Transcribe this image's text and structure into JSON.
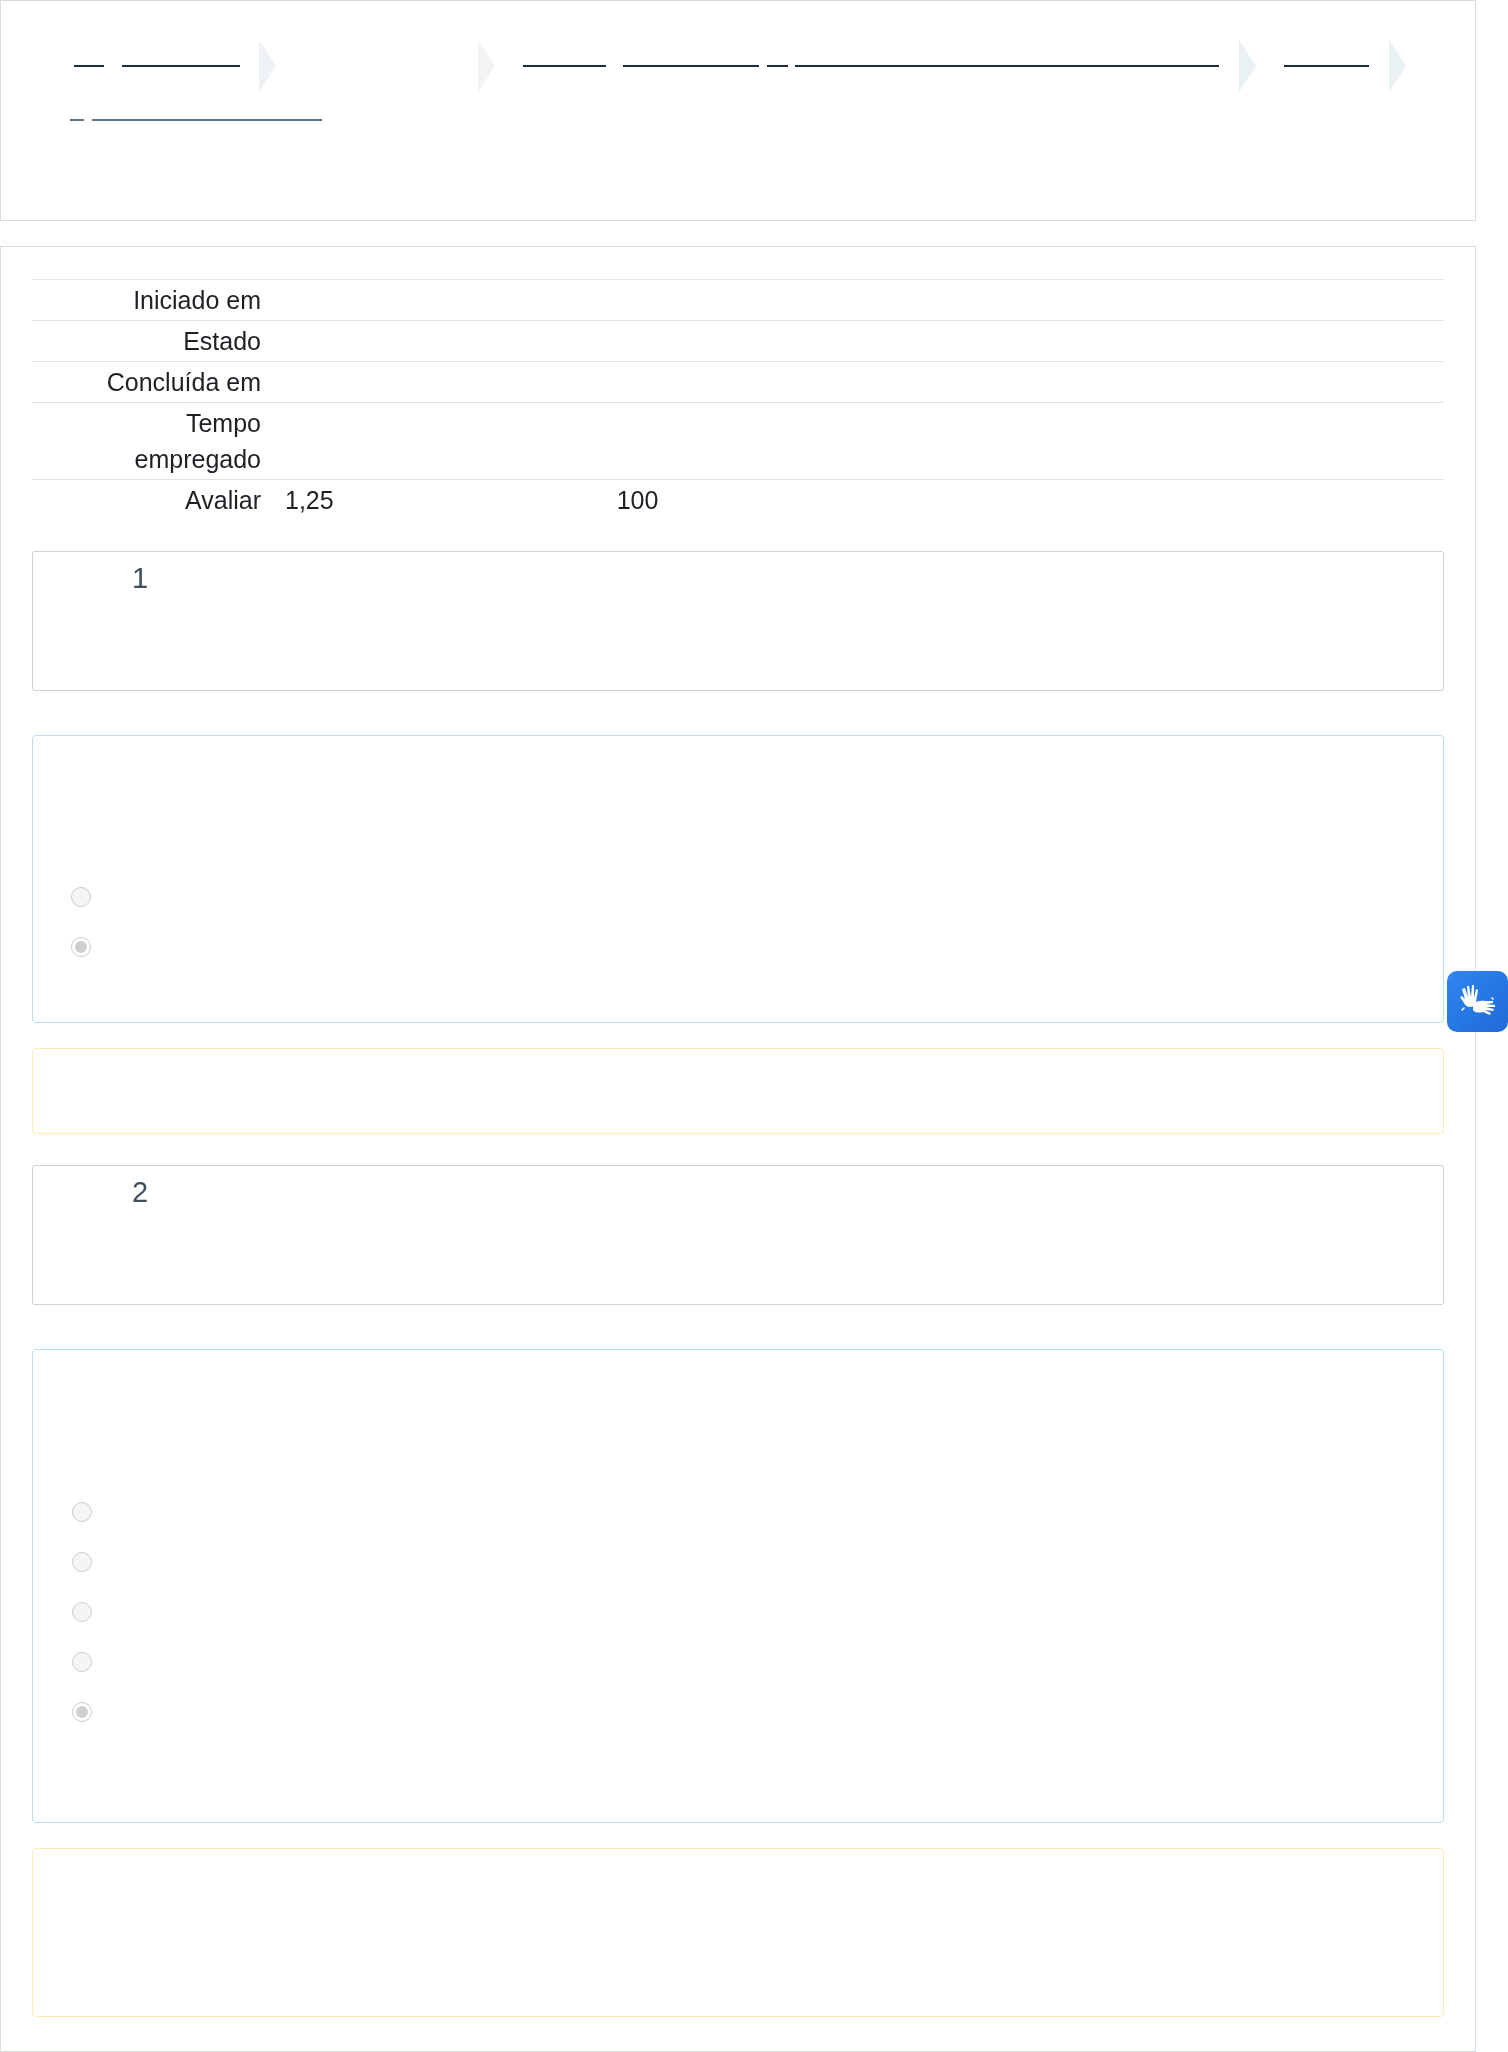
{
  "summary": {
    "rows": [
      {
        "label": "Iniciado em"
      },
      {
        "label": "Estado"
      },
      {
        "label": "Concluída em"
      },
      {
        "label": "Tempo empregado"
      },
      {
        "label": "Avaliar",
        "values": [
          "1,25",
          "100"
        ]
      }
    ]
  },
  "questions": [
    {
      "number": "1",
      "options": [
        {
          "selected": false
        },
        {
          "selected": true
        }
      ]
    },
    {
      "number": "2",
      "options": [
        {
          "selected": false
        },
        {
          "selected": false
        },
        {
          "selected": false
        },
        {
          "selected": false
        },
        {
          "selected": true
        }
      ]
    }
  ]
}
